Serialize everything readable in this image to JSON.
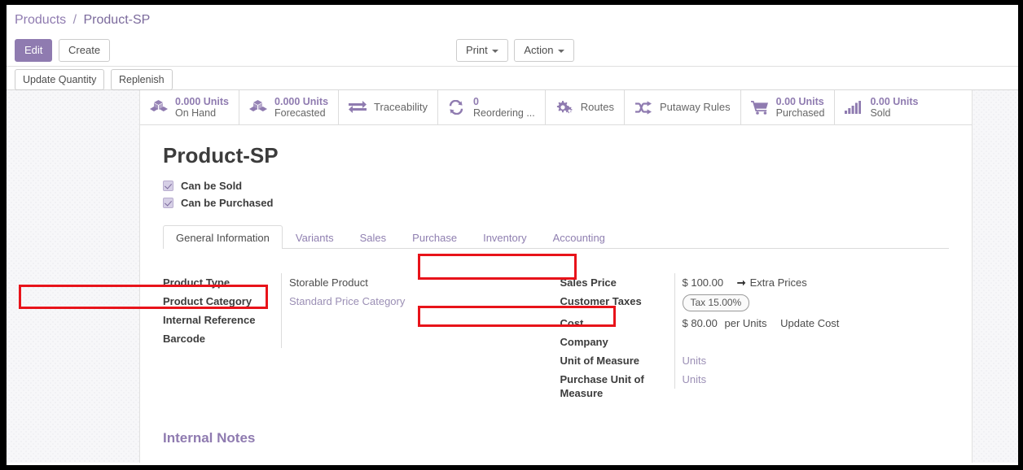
{
  "breadcrumb": {
    "root": "Products",
    "separator": "/",
    "current": "Product-SP"
  },
  "control_panel": {
    "edit_label": "Edit",
    "create_label": "Create",
    "print_label": "Print",
    "action_label": "Action"
  },
  "action_bar": {
    "update_quantity_label": "Update Quantity",
    "replenish_label": "Replenish"
  },
  "stat_buttons": [
    {
      "icon": "cubes-icon",
      "value": "0.000 Units",
      "label": "On Hand"
    },
    {
      "icon": "cubes-icon",
      "value": "0.000 Units",
      "label": "Forecasted"
    },
    {
      "icon": "exchange-arrows-icon",
      "value": "",
      "label": "Traceability"
    },
    {
      "icon": "refresh-icon",
      "value": "0",
      "label": "Reordering ..."
    },
    {
      "icon": "gears-icon",
      "value": "",
      "label": "Routes"
    },
    {
      "icon": "shuffle-icon",
      "value": "",
      "label": "Putaway Rules"
    },
    {
      "icon": "shopping-cart-icon",
      "value": "0.00 Units",
      "label": "Purchased"
    },
    {
      "icon": "bar-chart-icon",
      "value": "0.00 Units",
      "label": "Sold"
    }
  ],
  "product": {
    "title": "Product-SP",
    "can_be_sold_label": "Can be Sold",
    "can_be_purchased_label": "Can be Purchased",
    "can_be_sold_checked": true,
    "can_be_purchased_checked": true
  },
  "tabs": [
    {
      "label": "General Information",
      "active": true
    },
    {
      "label": "Variants",
      "active": false
    },
    {
      "label": "Sales",
      "active": false
    },
    {
      "label": "Purchase",
      "active": false
    },
    {
      "label": "Inventory",
      "active": false
    },
    {
      "label": "Accounting",
      "active": false
    }
  ],
  "form_left": {
    "product_type_label": "Product Type",
    "product_type_value": "Storable Product",
    "product_category_label": "Product Category",
    "product_category_value": "Standard Price Category",
    "internal_reference_label": "Internal Reference",
    "internal_reference_value": "",
    "barcode_label": "Barcode",
    "barcode_value": ""
  },
  "form_right": {
    "sales_price_label": "Sales Price",
    "sales_price_value": "$ 100.00",
    "extra_prices_label": "Extra Prices",
    "customer_taxes_label": "Customer Taxes",
    "customer_taxes_value": "Tax 15.00%",
    "cost_label": "Cost",
    "cost_value": "$ 80.00",
    "cost_suffix": "per Units",
    "update_cost_label": "Update Cost",
    "company_label": "Company",
    "company_value": "",
    "uom_label": "Unit of Measure",
    "uom_value": "Units",
    "purchase_uom_label": "Purchase Unit of Measure",
    "purchase_uom_value": "Units"
  },
  "internal_notes": {
    "title": "Internal Notes",
    "body": ""
  },
  "colors": {
    "accent_purple": "#8f7bb0",
    "link_purple": "#9b8fb5",
    "annotation_red": "#e8131a"
  }
}
